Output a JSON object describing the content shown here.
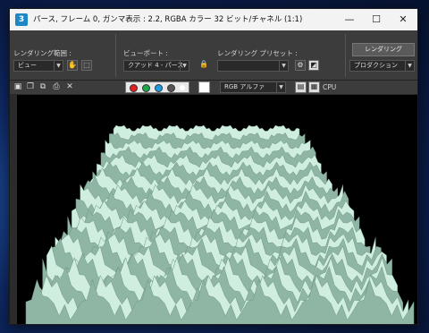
{
  "window": {
    "title": "パース, フレーム 0, ガンマ表示 : 2.2, RGBA カラー 32 ビット/チャネル (1:1)",
    "app_icon_glyph": "3",
    "minimize_glyph": "—",
    "maximize_glyph": "☐",
    "close_glyph": "✕"
  },
  "settings": {
    "render_area_label": "レンダリング範囲 :",
    "render_area_value": "ビュー",
    "viewport_label": "ビューポート :",
    "viewport_value": "クアッド 4 - パース",
    "preset_label": "レンダリング プリセット :",
    "preset_value": "",
    "render_button": "レンダリング",
    "production_value": "プロダクション"
  },
  "toolbar": {
    "channel_value": "RGB アルファ",
    "cpu_label": "CPU",
    "channel_colors": {
      "red": "#e02020",
      "green": "#1aa84a",
      "blue": "#1c9be0"
    }
  },
  "colors": {
    "surface_top": "#cfeee0",
    "surface_side": "#8fb5a5",
    "background": "#000000"
  }
}
